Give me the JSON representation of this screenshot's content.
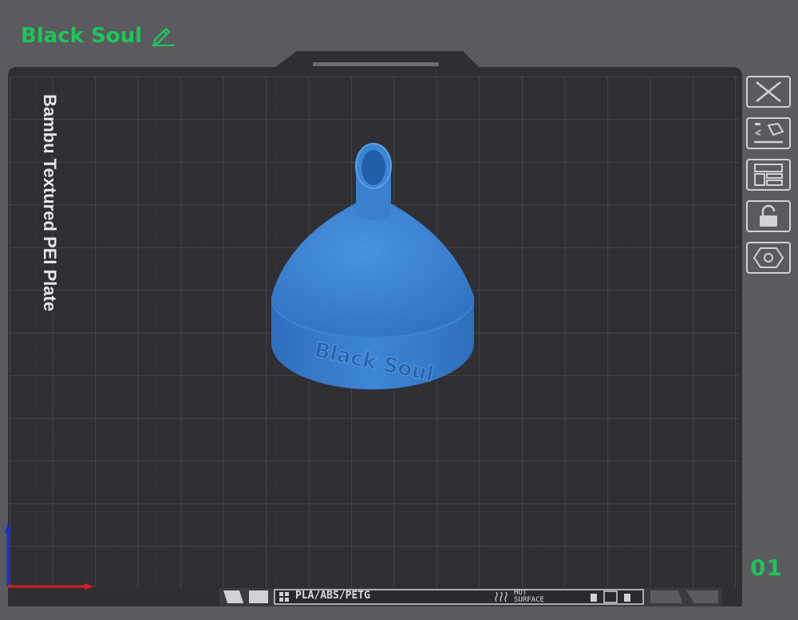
{
  "plate": {
    "name": "Black Soul",
    "type_label": "Bambu Textured PEI Plate",
    "number": "01"
  },
  "model": {
    "emboss_text": "Black Soul",
    "color": "#3a7fd0"
  },
  "bottom_strip": {
    "material": "PLA/ABS/PETG",
    "hot_line1": "HOT",
    "hot_line2": "SURFACE"
  },
  "colors": {
    "accent": "#1fc45a",
    "plate": "#2e2e33",
    "grid": "#44444a",
    "background": "#5a5a5f"
  },
  "toolbar": {
    "icons": [
      "close-icon",
      "auto-orient-icon",
      "arrange-icon",
      "lock-icon",
      "plate-settings-icon"
    ]
  }
}
